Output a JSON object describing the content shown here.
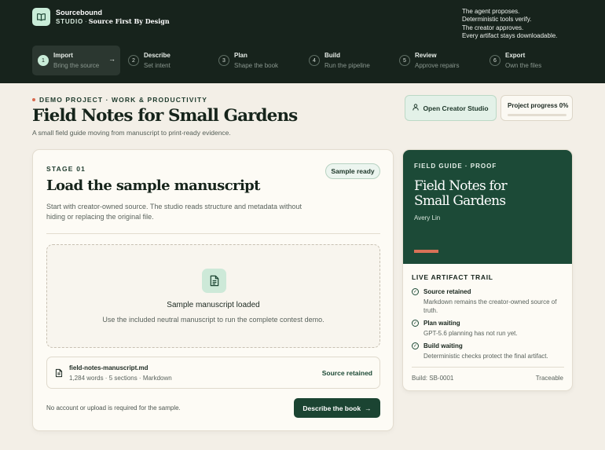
{
  "brand": {
    "name": "Sourcebound",
    "studio": "STUDIO",
    "separator": "·",
    "tagline": "Source First By Design",
    "logo_icon": "book-open-icon"
  },
  "motto": [
    "The agent proposes.",
    "Deterministic tools verify.",
    "The creator approves.",
    "Every artifact stays downloadable."
  ],
  "steps": [
    {
      "num": "1",
      "title": "Import",
      "sub": "Bring the source",
      "active": true
    },
    {
      "num": "2",
      "title": "Describe",
      "sub": "Set intent"
    },
    {
      "num": "3",
      "title": "Plan",
      "sub": "Shape the book"
    },
    {
      "num": "4",
      "title": "Build",
      "sub": "Run the pipeline"
    },
    {
      "num": "5",
      "title": "Review",
      "sub": "Approve repairs"
    },
    {
      "num": "6",
      "title": "Export",
      "sub": "Own the files"
    }
  ],
  "hero": {
    "eyebrow": "DEMO PROJECT · WORK & PRODUCTIVITY",
    "title": "Field Notes for Small Gardens",
    "description": "A small field guide moving from manuscript to print-ready evidence."
  },
  "actions": {
    "creator_studio": "Open Creator Studio",
    "progress_label": "Project progress 0%",
    "progress_value": 0
  },
  "stage": {
    "label": "STAGE 01",
    "badge": "Sample ready",
    "title": "Load the sample manuscript",
    "description": "Start with creator-owned source. The studio reads structure and metadata without hiding or replacing the original file.",
    "dropzone_title": "Sample manuscript loaded",
    "dropzone_sub": "Use the included neutral manuscript to run the complete contest demo.",
    "file": {
      "name": "field-notes-manuscript.md",
      "meta": "1,284 words · 5 sections · Markdown",
      "status": "Source retained"
    },
    "footer_note": "No account or upload is required for the sample.",
    "next_button": "Describe the book"
  },
  "proof": {
    "eyebrow": "FIELD GUIDE · PROOF",
    "title": "Field Notes for Small Gardens",
    "author": "Avery Lin",
    "trail_title": "LIVE ARTIFACT TRAIL",
    "trail": [
      {
        "name": "Source retained",
        "desc": "Markdown remains the creator-owned source of truth."
      },
      {
        "name": "Plan waiting",
        "desc": "GPT-5.6 planning has not run yet."
      },
      {
        "name": "Build waiting",
        "desc": "Deterministic checks protect the final artifact."
      }
    ],
    "build_id": "Build: SB-0001",
    "traceable": "Traceable"
  },
  "colors": {
    "topbar": "#17231c",
    "brand_green": "#1b4432",
    "mint": "#c9ecd8",
    "accent_coral": "#d97157",
    "background": "#f3efe7"
  }
}
